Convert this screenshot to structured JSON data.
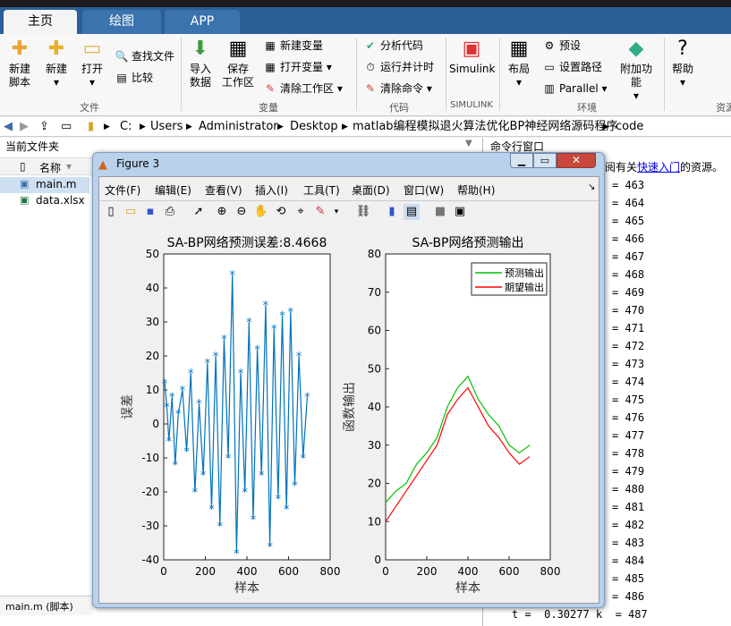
{
  "tabs": [
    "主页",
    "绘图",
    "APP"
  ],
  "ribbon": {
    "file": {
      "new_script": [
        "新建",
        "脚本"
      ],
      "new": "新建",
      "open": "打开",
      "find_files": "查找文件",
      "compare": "比较",
      "group": "文件"
    },
    "variable": {
      "import": [
        "导入",
        "数据"
      ],
      "save": [
        "保存",
        "工作区"
      ],
      "new_var": "新建变量",
      "open_var": "打开变量",
      "clear_ws": "清除工作区",
      "group": "变量"
    },
    "code": {
      "analyze": "分析代码",
      "run_timer": "运行并计时",
      "clear_cmd": "清除命令",
      "group": "代码"
    },
    "simulink": {
      "label": "Simulink",
      "group": "SIMULINK"
    },
    "env": {
      "layout": "布局",
      "prefs": "预设",
      "set_path": "设置路径",
      "parallel": "Parallel",
      "addons": "附加功能",
      "group": "环境"
    },
    "help": "帮助",
    "res_group": "资源"
  },
  "address": [
    "C:",
    "Users",
    "Administrator",
    "Desktop",
    "matlab编程模拟退火算法优化BP神经网络源码程序",
    "code"
  ],
  "left": {
    "title": "当前文件夹",
    "col_name": "名称",
    "files": [
      "main.m",
      "data.xlsx"
    ],
    "footer": "main.m  (脚本)"
  },
  "right": {
    "title": "命令行窗口",
    "notice_prefix": "阅有关",
    "notice_link": "快速入门",
    "notice_suffix": "的资源。",
    "lines": [
      "= 463",
      "= 464",
      "= 465",
      "= 466",
      "= 467",
      "= 468",
      "= 469",
      "= 470",
      "= 471",
      "= 472",
      "= 473",
      "= 474",
      "= 475",
      "= 476",
      "= 477",
      "= 478",
      "= 479",
      "= 480",
      "= 481",
      "= 482",
      "= 483",
      "= 484",
      "= 485",
      "= 486"
    ],
    "last_line": "t =  0.30277 k  = 487"
  },
  "figure": {
    "title": "Figure 3",
    "menus": [
      "文件(F)",
      "编辑(E)",
      "查看(V)",
      "插入(I)",
      "工具(T)",
      "桌面(D)",
      "窗口(W)",
      "帮助(H)"
    ]
  },
  "chart_data": [
    {
      "type": "line",
      "title": "SA-BP网络预测误差:8.4668",
      "xlabel": "样本",
      "ylabel": "误差",
      "xlim": [
        0,
        800
      ],
      "ylim": [
        -40,
        50
      ],
      "xticks": [
        0,
        200,
        400,
        600,
        800
      ],
      "yticks": [
        -40,
        -30,
        -20,
        -10,
        0,
        10,
        20,
        30,
        40,
        50
      ],
      "marker": "asterisk",
      "series": [
        {
          "color": "#0072bd",
          "x": [
            5,
            15,
            25,
            40,
            55,
            70,
            90,
            110,
            130,
            150,
            170,
            190,
            210,
            230,
            250,
            270,
            290,
            310,
            330,
            350,
            370,
            390,
            410,
            430,
            450,
            470,
            490,
            510,
            530,
            550,
            570,
            590,
            610,
            630,
            650,
            670,
            690
          ],
          "values": [
            12,
            5,
            -5,
            8,
            -12,
            3,
            10,
            -8,
            15,
            -20,
            6,
            -15,
            18,
            -25,
            20,
            -30,
            25,
            -10,
            44,
            -38,
            15,
            -20,
            30,
            -28,
            22,
            -15,
            35,
            -36,
            28,
            -22,
            32,
            -25,
            33,
            -18,
            20,
            -10,
            8
          ]
        }
      ]
    },
    {
      "type": "line",
      "title": "SA-BP网络预测输出",
      "xlabel": "样本",
      "ylabel": "函数输出",
      "xlim": [
        0,
        800
      ],
      "ylim": [
        0,
        80
      ],
      "xticks": [
        0,
        200,
        400,
        600,
        800
      ],
      "yticks": [
        0,
        10,
        20,
        30,
        40,
        50,
        60,
        70,
        80
      ],
      "legend_position": "top-right",
      "series": [
        {
          "name": "预测输出",
          "color": "#00c000",
          "x": [
            0,
            50,
            100,
            150,
            200,
            250,
            300,
            350,
            400,
            450,
            500,
            550,
            600,
            650,
            700
          ],
          "values": [
            15,
            18,
            20,
            25,
            28,
            32,
            40,
            45,
            48,
            42,
            38,
            35,
            30,
            28,
            30
          ]
        },
        {
          "name": "期望输出",
          "color": "#ff0000",
          "x": [
            0,
            50,
            100,
            150,
            200,
            250,
            300,
            350,
            400,
            450,
            500,
            550,
            600,
            650,
            700
          ],
          "values": [
            10,
            14,
            18,
            22,
            26,
            30,
            38,
            42,
            45,
            40,
            35,
            32,
            28,
            25,
            27
          ]
        }
      ]
    }
  ]
}
